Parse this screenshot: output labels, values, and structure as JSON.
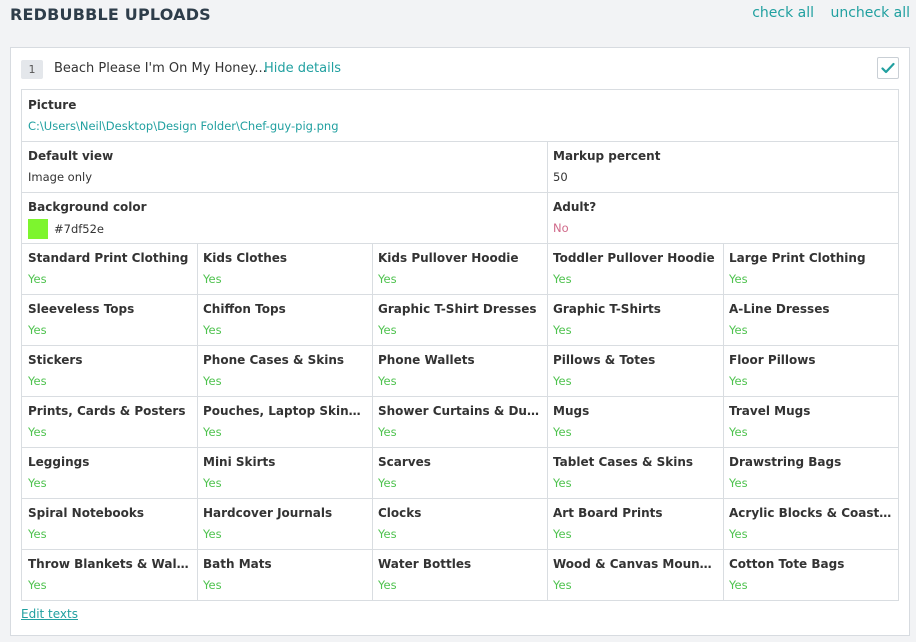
{
  "header": {
    "title": "REDBUBBLE UPLOADS",
    "check_all": "check all",
    "uncheck_all": "uncheck all"
  },
  "upload": {
    "index": "1",
    "title": "Beach Please I'm On My Honey...",
    "hide_details": "Hide details",
    "checked": true,
    "checkbox_icon": "check-icon",
    "picture": {
      "label": "Picture",
      "value": "C:\\Users\\Neil\\Desktop\\Design Folder\\Chef-guy-pig.png"
    },
    "default_view": {
      "label": "Default view",
      "value": "Image only"
    },
    "markup_percent": {
      "label": "Markup percent",
      "value": "50"
    },
    "background_color": {
      "label": "Background color",
      "value": "#7df52e",
      "swatch": "#7df52e"
    },
    "adult": {
      "label": "Adult?",
      "value": "No"
    },
    "products": [
      {
        "label": "Standard Print Clothing",
        "value": "Yes"
      },
      {
        "label": "Kids Clothes",
        "value": "Yes"
      },
      {
        "label": "Kids Pullover Hoodie",
        "value": "Yes"
      },
      {
        "label": "Toddler Pullover Hoodie",
        "value": "Yes"
      },
      {
        "label": "Large Print Clothing",
        "value": "Yes"
      },
      {
        "label": "Sleeveless Tops",
        "value": "Yes"
      },
      {
        "label": "Chiffon Tops",
        "value": "Yes"
      },
      {
        "label": "Graphic T-Shirt Dresses",
        "value": "Yes"
      },
      {
        "label": "Graphic T-Shirts",
        "value": "Yes"
      },
      {
        "label": "A-Line Dresses",
        "value": "Yes"
      },
      {
        "label": "Stickers",
        "value": "Yes"
      },
      {
        "label": "Phone Cases & Skins",
        "value": "Yes"
      },
      {
        "label": "Phone Wallets",
        "value": "Yes"
      },
      {
        "label": "Pillows & Totes",
        "value": "Yes"
      },
      {
        "label": "Floor Pillows",
        "value": "Yes"
      },
      {
        "label": "Prints, Cards & Posters",
        "value": "Yes"
      },
      {
        "label": "Pouches, Laptop Skins & ...",
        "value": "Yes"
      },
      {
        "label": "Shower Curtains & Duvets",
        "value": "Yes"
      },
      {
        "label": "Mugs",
        "value": "Yes"
      },
      {
        "label": "Travel Mugs",
        "value": "Yes"
      },
      {
        "label": "Leggings",
        "value": "Yes"
      },
      {
        "label": "Mini Skirts",
        "value": "Yes"
      },
      {
        "label": "Scarves",
        "value": "Yes"
      },
      {
        "label": "Tablet Cases & Skins",
        "value": "Yes"
      },
      {
        "label": "Drawstring Bags",
        "value": "Yes"
      },
      {
        "label": "Spiral Notebooks",
        "value": "Yes"
      },
      {
        "label": "Hardcover Journals",
        "value": "Yes"
      },
      {
        "label": "Clocks",
        "value": "Yes"
      },
      {
        "label": "Art Board Prints",
        "value": "Yes"
      },
      {
        "label": "Acrylic Blocks & Coasters",
        "value": "Yes"
      },
      {
        "label": "Throw Blankets & Wall Ta...",
        "value": "Yes"
      },
      {
        "label": "Bath Mats",
        "value": "Yes"
      },
      {
        "label": "Water Bottles",
        "value": "Yes"
      },
      {
        "label": "Wood & Canvas Mounted ...",
        "value": "Yes"
      },
      {
        "label": "Cotton Tote Bags",
        "value": "Yes"
      }
    ],
    "edit_texts": "Edit texts"
  },
  "colors": {
    "accent": "#21a0a0",
    "yes": "#4ec24e",
    "no": "#d06a8a",
    "title": "#2e3d4a"
  }
}
